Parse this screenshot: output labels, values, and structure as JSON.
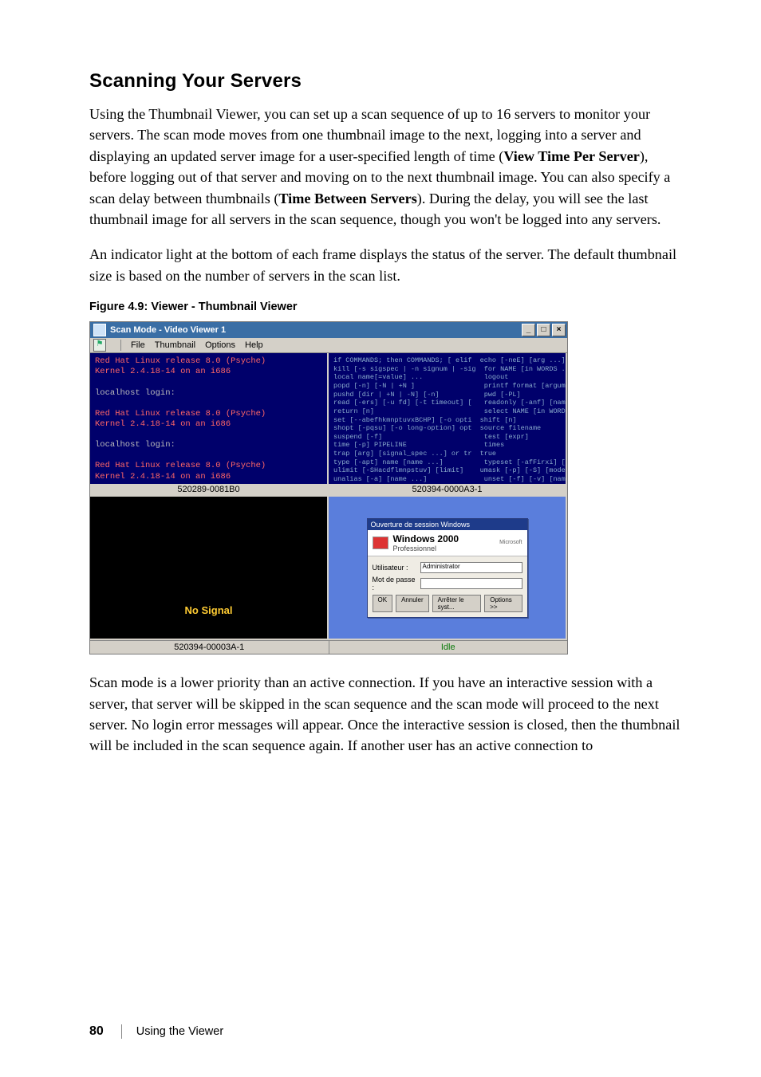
{
  "heading": "Scanning Your Servers",
  "para1_a": "Using the Thumbnail Viewer, you can set up a scan sequence of up to 16 servers to monitor your servers. The scan mode moves from one thumbnail image to the next, logging into a server and displaying an updated server image for a user-specified length of time (",
  "para1_opt1": "View Time Per Server",
  "para1_b": "), before logging out of that server and moving on to the next thumbnail image. You can also specify a scan delay between thumbnails (",
  "para1_opt2": "Time Between Servers",
  "para1_c": "). During the delay, you will see the last thumbnail image for all servers in the scan sequence, though you won't be logged into any servers.",
  "para2": "An indicator light at the bottom of each frame displays the status of the server. The default thumbnail size is based on the number of servers in the scan list.",
  "figure_caption": "Figure 4.9: Viewer - Thumbnail Viewer",
  "win_title": "Scan Mode - Video Viewer 1",
  "menu": {
    "file": "File",
    "thumbnail": "Thumbnail",
    "options": "Options",
    "help": "Help"
  },
  "window_buttons": {
    "min": "_",
    "max": "□",
    "close": "×"
  },
  "frame1": {
    "lines": [
      "Red Hat Linux release 8.0 (Psyche)",
      "Kernel 2.4.18-14 on an i686",
      "",
      "localhost login:",
      "",
      "Red Hat Linux release 8.0 (Psyche)",
      "Kernel 2.4.18-14 on an i686",
      "",
      "localhost login:",
      "",
      "Red Hat Linux release 8.0 (Psyche)",
      "Kernel 2.4.18-14 on an i686"
    ],
    "label": "520289-0081B0"
  },
  "frame2": {
    "label": "520394-0000A3-1"
  },
  "frame3": {
    "nosignal": "No Signal"
  },
  "frame4_login": {
    "titlebar": "Ouverture de session Windows",
    "brand": "Windows",
    "brand_year": "2000",
    "brand_sub": "Professionnel",
    "ms": "Microsoft",
    "user_label": "Utilisateur :",
    "user_value": "Administrator",
    "pass_label": "Mot de passe :",
    "btn_ok": "OK",
    "btn_cancel": "Annuler",
    "btn_shutdown": "Arrêter le syst...",
    "btn_options": "Options >>"
  },
  "status": {
    "left": "520394-00003A-1",
    "right": "Idle"
  },
  "para3": "Scan mode is a lower priority than an active connection. If you have an interactive session with a server, that server will be skipped in the scan sequence and the scan mode will proceed to the next server. No login error messages will appear. Once the interactive session is closed, then the thumbnail will be included in the scan sequence again. If another user has an active connection to",
  "footer": {
    "page": "80",
    "section": "Using the Viewer"
  }
}
